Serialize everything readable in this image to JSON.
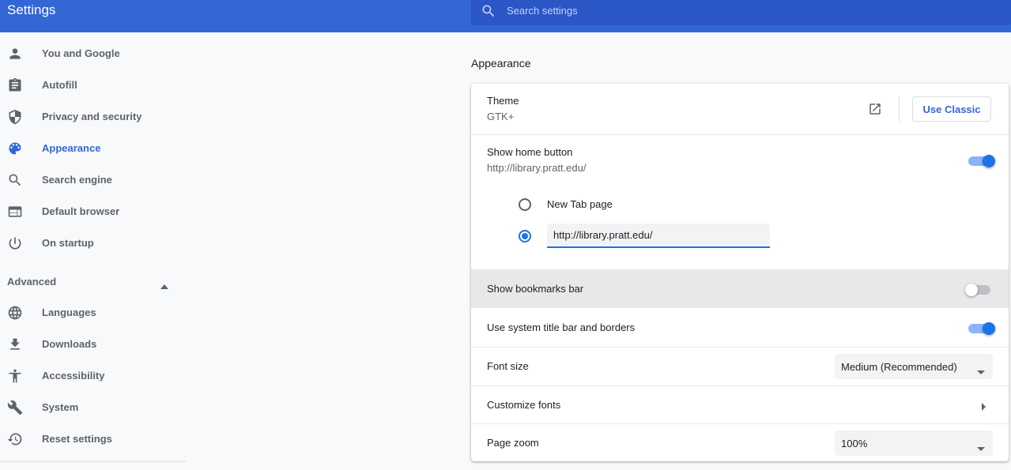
{
  "header": {
    "title": "Settings",
    "search_placeholder": "Search settings"
  },
  "sidebar": {
    "items": [
      {
        "label": "You and Google",
        "icon": "person-icon"
      },
      {
        "label": "Autofill",
        "icon": "clipboard-icon"
      },
      {
        "label": "Privacy and security",
        "icon": "shield-icon"
      },
      {
        "label": "Appearance",
        "icon": "palette-icon",
        "active": true
      },
      {
        "label": "Search engine",
        "icon": "search-icon"
      },
      {
        "label": "Default browser",
        "icon": "browser-window-icon"
      },
      {
        "label": "On startup",
        "icon": "power-icon"
      }
    ],
    "advanced_label": "Advanced",
    "advanced_items": [
      {
        "label": "Languages",
        "icon": "globe-icon"
      },
      {
        "label": "Downloads",
        "icon": "download-icon"
      },
      {
        "label": "Accessibility",
        "icon": "accessibility-icon"
      },
      {
        "label": "System",
        "icon": "wrench-icon"
      },
      {
        "label": "Reset settings",
        "icon": "restore-icon"
      }
    ]
  },
  "appearance": {
    "section_title": "Appearance",
    "theme": {
      "label": "Theme",
      "value": "GTK+",
      "button": "Use Classic"
    },
    "home_button": {
      "label": "Show home button",
      "value": "http://library.pratt.edu/",
      "enabled": true,
      "option_new_tab": "New Tab page",
      "selected_option": "custom_url",
      "custom_url": "http://library.pratt.edu/"
    },
    "bookmarks_bar": {
      "label": "Show bookmarks bar",
      "enabled": false
    },
    "system_title_bar": {
      "label": "Use system title bar and borders",
      "enabled": true
    },
    "font_size": {
      "label": "Font size",
      "value": "Medium (Recommended)"
    },
    "customize_fonts": {
      "label": "Customize fonts"
    },
    "page_zoom": {
      "label": "Page zoom",
      "value": "100%"
    }
  },
  "colors": {
    "accent": "#3367d6",
    "toggle_on": "#1a73e8",
    "header_bg": "#3367d6"
  }
}
